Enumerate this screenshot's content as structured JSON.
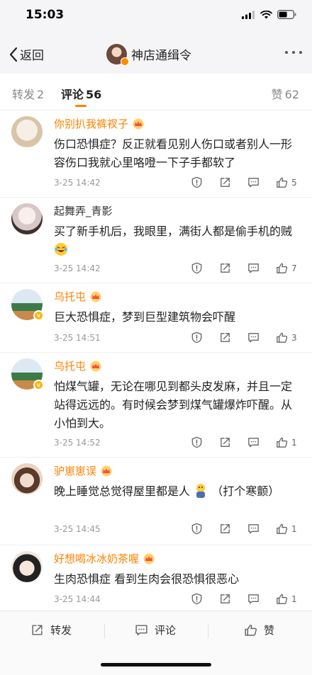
{
  "status": {
    "time": "15:03"
  },
  "nav": {
    "back_label": "返回",
    "title": "神店通缉令"
  },
  "tabs": [
    {
      "label": "转发",
      "count": "2"
    },
    {
      "label": "评论",
      "count": "56"
    },
    {
      "label": "赞",
      "count": "62"
    }
  ],
  "comments": [
    {
      "name": "你别扒我裤衩子",
      "text": "伤口恐惧症？反正就看见别人伤口或者别人一形容伤口我就心里咯噔一下子手都软了",
      "time": "3-25 14:42",
      "likes": "5"
    },
    {
      "name": "起舞弄_青影",
      "text": "买了新手机后，我眼里，满街人都是偷手机的贼",
      "time": "3-25 14:42",
      "likes": "7"
    },
    {
      "name": "乌托屯",
      "text": "巨大恐惧症，梦到巨型建筑物会吓醒",
      "time": "3-25 14:51",
      "likes": "3"
    },
    {
      "name": "乌托屯",
      "text": "怕煤气罐，无论在哪见到都头皮发麻，并且一定站得远远的。有时候会梦到煤气罐爆炸吓醒。从小怕到大。",
      "time": "3-25 14:52",
      "likes": "1"
    },
    {
      "name": "驴崽崽误",
      "text": "晚上睡觉总觉得屋里都是人",
      "text2": "（打个寒颤）",
      "time": "3-25 14:45",
      "likes": "1"
    },
    {
      "name": "好想喝冰冰奶茶喔",
      "text": "生肉恐惧症 看到生肉会很恐惧很恶心",
      "time": "3-25 14:44",
      "likes": "1"
    }
  ],
  "bottom": {
    "repost_label": "转发",
    "comment_label": "评论",
    "like_label": "赞"
  },
  "colors": {
    "accent": "#ff8200",
    "nav_bg": "#f5f5f7"
  }
}
